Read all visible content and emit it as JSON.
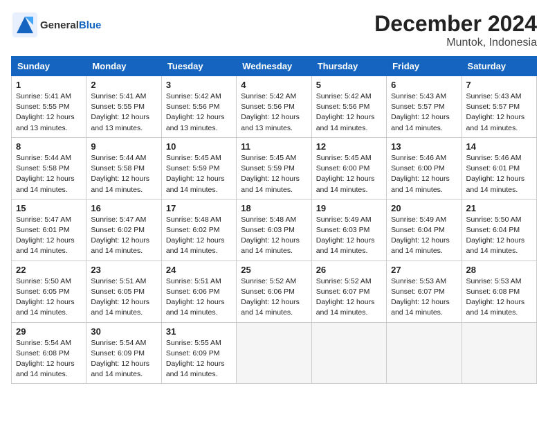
{
  "header": {
    "logo_general": "General",
    "logo_blue": "Blue",
    "title": "December 2024",
    "subtitle": "Muntok, Indonesia"
  },
  "weekdays": [
    "Sunday",
    "Monday",
    "Tuesday",
    "Wednesday",
    "Thursday",
    "Friday",
    "Saturday"
  ],
  "weeks": [
    [
      {
        "day": 1,
        "rise": "5:41 AM",
        "set": "5:55 PM",
        "daylight": "12 hours and 13 minutes."
      },
      {
        "day": 2,
        "rise": "5:41 AM",
        "set": "5:55 PM",
        "daylight": "12 hours and 13 minutes."
      },
      {
        "day": 3,
        "rise": "5:42 AM",
        "set": "5:56 PM",
        "daylight": "12 hours and 13 minutes."
      },
      {
        "day": 4,
        "rise": "5:42 AM",
        "set": "5:56 PM",
        "daylight": "12 hours and 13 minutes."
      },
      {
        "day": 5,
        "rise": "5:42 AM",
        "set": "5:56 PM",
        "daylight": "12 hours and 14 minutes."
      },
      {
        "day": 6,
        "rise": "5:43 AM",
        "set": "5:57 PM",
        "daylight": "12 hours and 14 minutes."
      },
      {
        "day": 7,
        "rise": "5:43 AM",
        "set": "5:57 PM",
        "daylight": "12 hours and 14 minutes."
      }
    ],
    [
      {
        "day": 8,
        "rise": "5:44 AM",
        "set": "5:58 PM",
        "daylight": "12 hours and 14 minutes."
      },
      {
        "day": 9,
        "rise": "5:44 AM",
        "set": "5:58 PM",
        "daylight": "12 hours and 14 minutes."
      },
      {
        "day": 10,
        "rise": "5:45 AM",
        "set": "5:59 PM",
        "daylight": "12 hours and 14 minutes."
      },
      {
        "day": 11,
        "rise": "5:45 AM",
        "set": "5:59 PM",
        "daylight": "12 hours and 14 minutes."
      },
      {
        "day": 12,
        "rise": "5:45 AM",
        "set": "6:00 PM",
        "daylight": "12 hours and 14 minutes."
      },
      {
        "day": 13,
        "rise": "5:46 AM",
        "set": "6:00 PM",
        "daylight": "12 hours and 14 minutes."
      },
      {
        "day": 14,
        "rise": "5:46 AM",
        "set": "6:01 PM",
        "daylight": "12 hours and 14 minutes."
      }
    ],
    [
      {
        "day": 15,
        "rise": "5:47 AM",
        "set": "6:01 PM",
        "daylight": "12 hours and 14 minutes."
      },
      {
        "day": 16,
        "rise": "5:47 AM",
        "set": "6:02 PM",
        "daylight": "12 hours and 14 minutes."
      },
      {
        "day": 17,
        "rise": "5:48 AM",
        "set": "6:02 PM",
        "daylight": "12 hours and 14 minutes."
      },
      {
        "day": 18,
        "rise": "5:48 AM",
        "set": "6:03 PM",
        "daylight": "12 hours and 14 minutes."
      },
      {
        "day": 19,
        "rise": "5:49 AM",
        "set": "6:03 PM",
        "daylight": "12 hours and 14 minutes."
      },
      {
        "day": 20,
        "rise": "5:49 AM",
        "set": "6:04 PM",
        "daylight": "12 hours and 14 minutes."
      },
      {
        "day": 21,
        "rise": "5:50 AM",
        "set": "6:04 PM",
        "daylight": "12 hours and 14 minutes."
      }
    ],
    [
      {
        "day": 22,
        "rise": "5:50 AM",
        "set": "6:05 PM",
        "daylight": "12 hours and 14 minutes."
      },
      {
        "day": 23,
        "rise": "5:51 AM",
        "set": "6:05 PM",
        "daylight": "12 hours and 14 minutes."
      },
      {
        "day": 24,
        "rise": "5:51 AM",
        "set": "6:06 PM",
        "daylight": "12 hours and 14 minutes."
      },
      {
        "day": 25,
        "rise": "5:52 AM",
        "set": "6:06 PM",
        "daylight": "12 hours and 14 minutes."
      },
      {
        "day": 26,
        "rise": "5:52 AM",
        "set": "6:07 PM",
        "daylight": "12 hours and 14 minutes."
      },
      {
        "day": 27,
        "rise": "5:53 AM",
        "set": "6:07 PM",
        "daylight": "12 hours and 14 minutes."
      },
      {
        "day": 28,
        "rise": "5:53 AM",
        "set": "6:08 PM",
        "daylight": "12 hours and 14 minutes."
      }
    ],
    [
      {
        "day": 29,
        "rise": "5:54 AM",
        "set": "6:08 PM",
        "daylight": "12 hours and 14 minutes."
      },
      {
        "day": 30,
        "rise": "5:54 AM",
        "set": "6:09 PM",
        "daylight": "12 hours and 14 minutes."
      },
      {
        "day": 31,
        "rise": "5:55 AM",
        "set": "6:09 PM",
        "daylight": "12 hours and 14 minutes."
      },
      null,
      null,
      null,
      null
    ]
  ],
  "labels": {
    "sunrise": "Sunrise:",
    "sunset": "Sunset:",
    "daylight": "Daylight:"
  }
}
